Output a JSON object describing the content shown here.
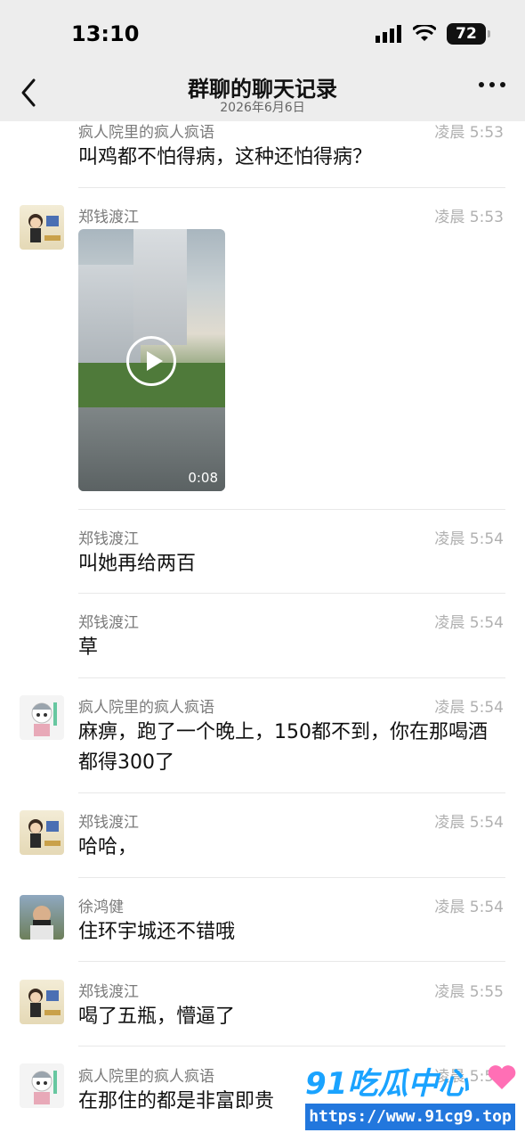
{
  "status": {
    "time": "13:10",
    "battery": "72"
  },
  "header": {
    "title": "群聊的聊天记录",
    "subtitle": "2026年6月6日"
  },
  "messages": [
    {
      "sender": "疯人院里的疯人疯语",
      "time": "凌晨 5:53",
      "text": "叫鸡都不怕得病，这种还怕得病？"
    },
    {
      "sender": "郑钱渡江",
      "time": "凌晨 5:53",
      "video_duration": "0:08"
    },
    {
      "sender": "郑钱渡江",
      "time": "凌晨 5:54",
      "text": "叫她再给两百"
    },
    {
      "sender": "郑钱渡江",
      "time": "凌晨 5:54",
      "text": "草"
    },
    {
      "sender": "疯人院里的疯人疯语",
      "time": "凌晨 5:54",
      "text": "麻痹，跑了一个晚上，150都不到，你在那喝酒都得300了"
    },
    {
      "sender": "郑钱渡江",
      "time": "凌晨 5:54",
      "text": "哈哈，"
    },
    {
      "sender": "徐鸿健",
      "time": "凌晨 5:54",
      "text": "住环宇城还不错哦"
    },
    {
      "sender": "郑钱渡江",
      "time": "凌晨 5:55",
      "text": "喝了五瓶，懵逼了"
    },
    {
      "sender": "疯人院里的疯人疯语",
      "time": "凌晨 5:55",
      "text": "在那住的都是非富即贵"
    }
  ],
  "watermark": {
    "logo": "91吃瓜中心",
    "url": "https://www.91cg9.top"
  }
}
